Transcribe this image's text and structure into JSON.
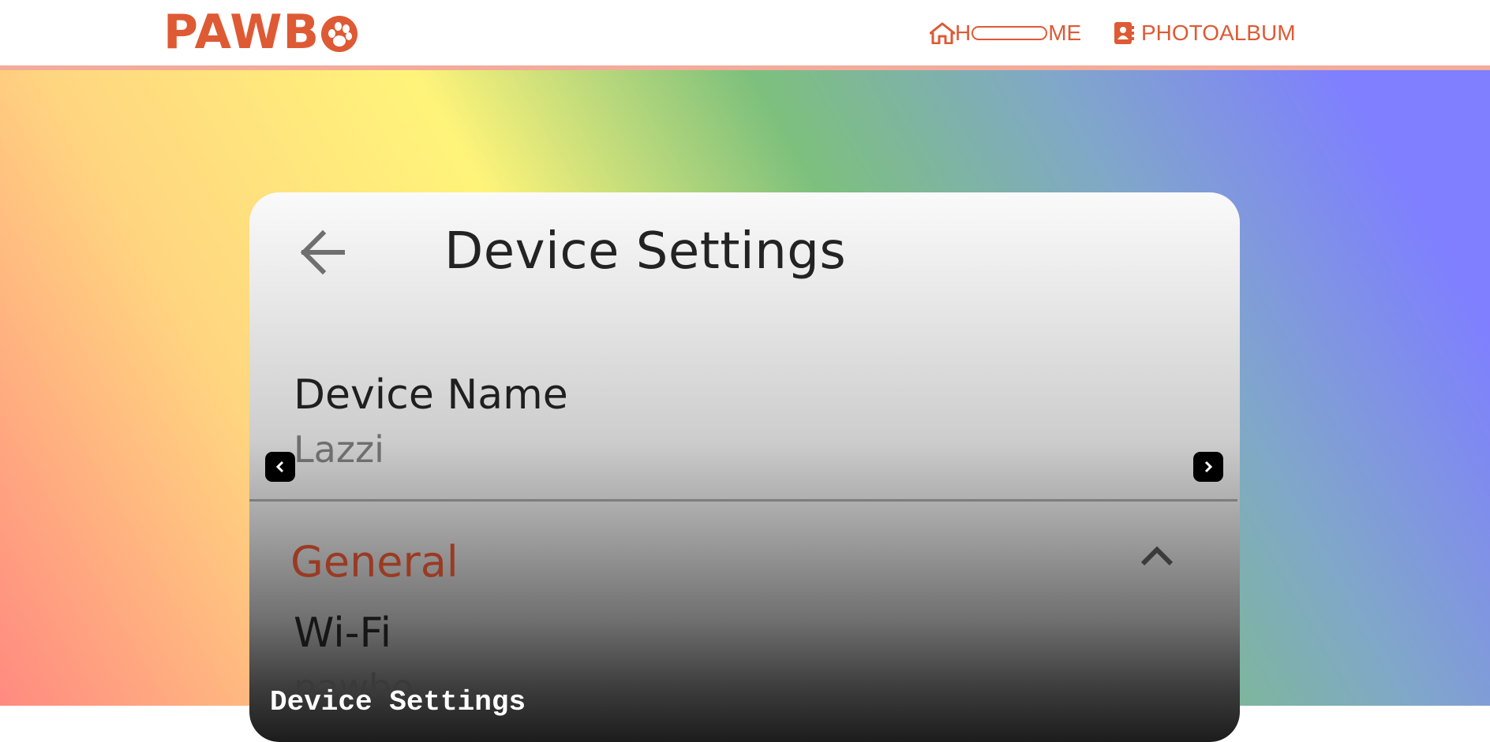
{
  "header": {
    "logo_text": "PAWB",
    "nav": {
      "home_label_start": "H",
      "home_label_end": "ME",
      "album_label": "PHOTOALBUM"
    }
  },
  "carousel": {
    "slide": {
      "title": "Device Settings",
      "device_name_label": "Device Name",
      "device_name_value": "Lazzi",
      "section_label": "General",
      "wifi_label": "Wi-Fi",
      "wifi_value": "pawbo"
    },
    "caption": "Device Settings"
  },
  "colors": {
    "brand": "#de5a34",
    "header_border": "#f3ab9b",
    "section_label": "#9b3a23"
  },
  "icons": {
    "home": "home-icon",
    "album": "contact-card-icon",
    "back": "arrow-left-icon",
    "expand": "chevron-up-icon",
    "prev": "chevron-left-icon",
    "next": "chevron-right-icon"
  }
}
